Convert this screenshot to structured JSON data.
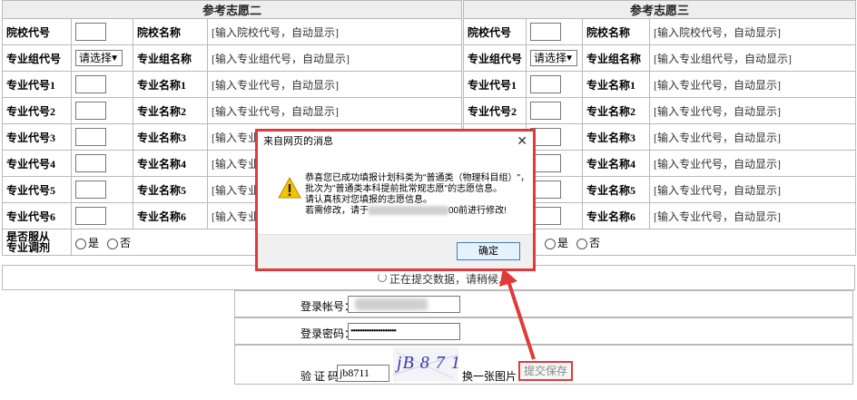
{
  "left_panel": {
    "header": "参考志愿二",
    "school_code_label": "院校代号",
    "school_name_label": "院校名称",
    "school_name_placeholder": "[输入院校代号，自动显示]",
    "group_code_label": "专业组代号",
    "group_select_value": "请选择",
    "group_name_label": "专业组名称",
    "group_name_placeholder": "[输入专业组代号，自动显示]",
    "majors": [
      {
        "code_label": "专业代号1",
        "name_label": "专业名称1",
        "placeholder": "[输入专业代号，自动显示]"
      },
      {
        "code_label": "专业代号2",
        "name_label": "专业名称2",
        "placeholder": "[输入专业代号，自动显示]"
      },
      {
        "code_label": "专业代号3",
        "name_label": "专业名称3",
        "placeholder": "[输入专业"
      },
      {
        "code_label": "专业代号4",
        "name_label": "专业名称4",
        "placeholder": "[输入专业"
      },
      {
        "code_label": "专业代号5",
        "name_label": "专业名称5",
        "placeholder": "[输入专业"
      },
      {
        "code_label": "专业代号6",
        "name_label": "专业名称6",
        "placeholder": "[输入专业"
      }
    ],
    "adjust_label_line1": "是否服从",
    "adjust_label_line2": "专业调剂",
    "yes": "是",
    "no": "否"
  },
  "right_panel": {
    "header": "参考志愿三",
    "school_code_label": "院校代号",
    "school_name_label": "院校名称",
    "school_name_placeholder": "[输入院校代号，自动显示]",
    "group_code_label": "专业组代号",
    "group_select_value": "请选择",
    "group_name_label": "专业组名称",
    "group_name_placeholder": "[输入专业组代号，自动显示]",
    "majors": [
      {
        "code_label": "专业代号1",
        "name_label": "专业名称1",
        "placeholder": "[输入专业代号，自动显示]"
      },
      {
        "code_label": "专业代号2",
        "name_label": "专业名称2",
        "placeholder": "[输入专业代号，自动显示]"
      },
      {
        "code_label": "",
        "name_label": "专业名称3",
        "placeholder": "[输入专业代号，自动显示]"
      },
      {
        "code_label": "",
        "name_label": "专业名称4",
        "placeholder": "[输入专业代号，自动显示]"
      },
      {
        "code_label": "",
        "name_label": "专业名称5",
        "placeholder": "[输入专业代号，自动显示]"
      },
      {
        "code_label": "",
        "name_label": "专业名称6",
        "placeholder": "[输入专业代号，自动显示]"
      }
    ],
    "yes": "是",
    "no": "否"
  },
  "status": {
    "saving_text": "正在提交数据，请稍候......"
  },
  "login": {
    "account_label": "登录帐号：",
    "password_label": "登录密码：",
    "password_value": "••••••••••••••••••••",
    "captcha_label": "验 证 码：",
    "captcha_value": "jb8711",
    "captcha_image_text": "jB 8 7 1 1",
    "change_image": "换一张图片",
    "submit": "提交保存"
  },
  "dialog": {
    "title": "来自网页的消息",
    "close": "✕",
    "line1": "恭喜您已成功填报计划科类为\"普通类（物理科目组）\"，",
    "line2": "批次为\"普通类本科提前批常规志愿\"的志愿信息。",
    "line3": "请认真核对您填报的志愿信息。",
    "line4_start": "若需修改，请于",
    "line4_end": "00前进行修改!",
    "ok": "确定"
  },
  "colors": {
    "highlight_red": "#e03a3a",
    "header_bg": "#eeeeee",
    "border": "#b9b9b9",
    "warning_yellow": "#f5c400"
  }
}
